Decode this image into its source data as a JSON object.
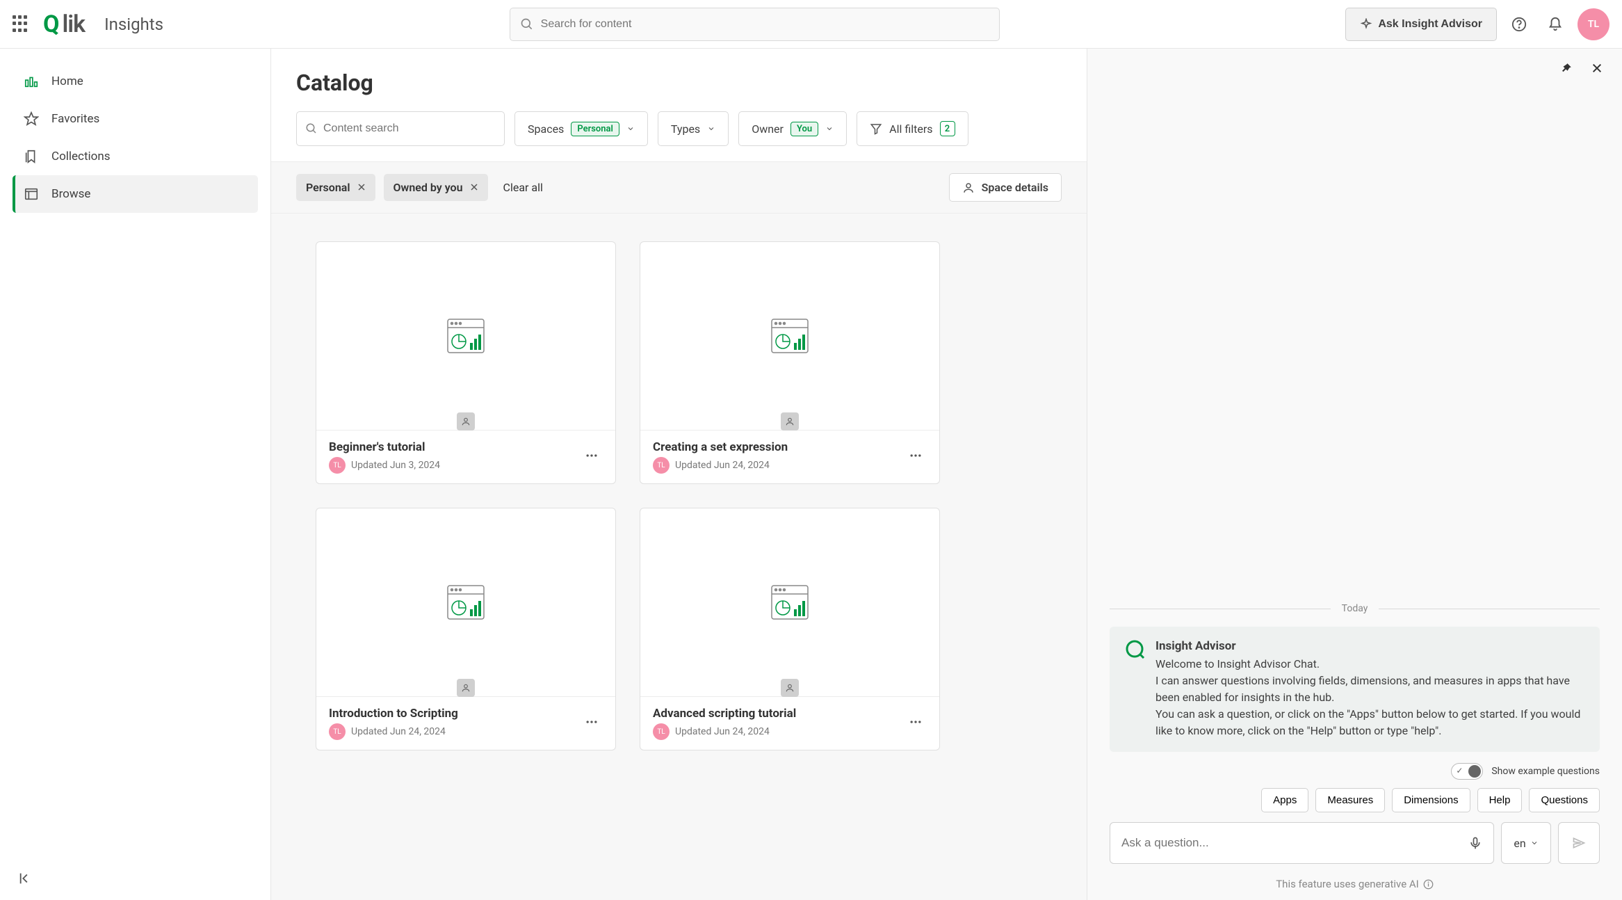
{
  "header": {
    "product_name": "Insights",
    "logo_text_q": "Q",
    "logo_text_lik": "lik",
    "search_placeholder": "Search for content",
    "ask_advisor_label": "Ask Insight Advisor",
    "user_initials": "TL"
  },
  "sidebar": {
    "items": [
      {
        "label": "Home"
      },
      {
        "label": "Favorites"
      },
      {
        "label": "Collections"
      },
      {
        "label": "Browse"
      }
    ]
  },
  "catalog": {
    "title": "Catalog",
    "content_search_placeholder": "Content search",
    "filters": {
      "spaces_label": "Spaces",
      "spaces_badge": "Personal",
      "types_label": "Types",
      "owner_label": "Owner",
      "owner_badge": "You",
      "all_filters_label": "All filters",
      "all_filters_count": "2"
    },
    "chips": [
      {
        "label": "Personal"
      },
      {
        "label": "Owned by you"
      }
    ],
    "clear_all_label": "Clear all",
    "space_details_label": "Space details",
    "cards": [
      {
        "title": "Beginner's tutorial",
        "updated": "Updated Jun 3, 2024",
        "owner_initials": "TL"
      },
      {
        "title": "Creating a set expression",
        "updated": "Updated Jun 24, 2024",
        "owner_initials": "TL"
      },
      {
        "title": "Introduction to Scripting",
        "updated": "Updated Jun 24, 2024",
        "owner_initials": "TL"
      },
      {
        "title": "Advanced scripting tutorial",
        "updated": "Updated Jun 24, 2024",
        "owner_initials": "TL"
      }
    ]
  },
  "advisor_panel": {
    "day_label": "Today",
    "msg_title": "Insight Advisor",
    "msg_body_1": "Welcome to Insight Advisor Chat.",
    "msg_body_2": "I can answer questions involving fields, dimensions, and measures in apps that have been enabled for insights in the hub.",
    "msg_body_3": "You can ask a question, or click on the \"Apps\" button below to get started. If you would like to know more, click on the \"Help\" button or type \"help\".",
    "show_examples_label": "Show example questions",
    "quick_buttons": [
      "Apps",
      "Measures",
      "Dimensions",
      "Help",
      "Questions"
    ],
    "ask_placeholder": "Ask a question...",
    "lang": "en",
    "disclaimer": "This feature uses generative AI"
  }
}
